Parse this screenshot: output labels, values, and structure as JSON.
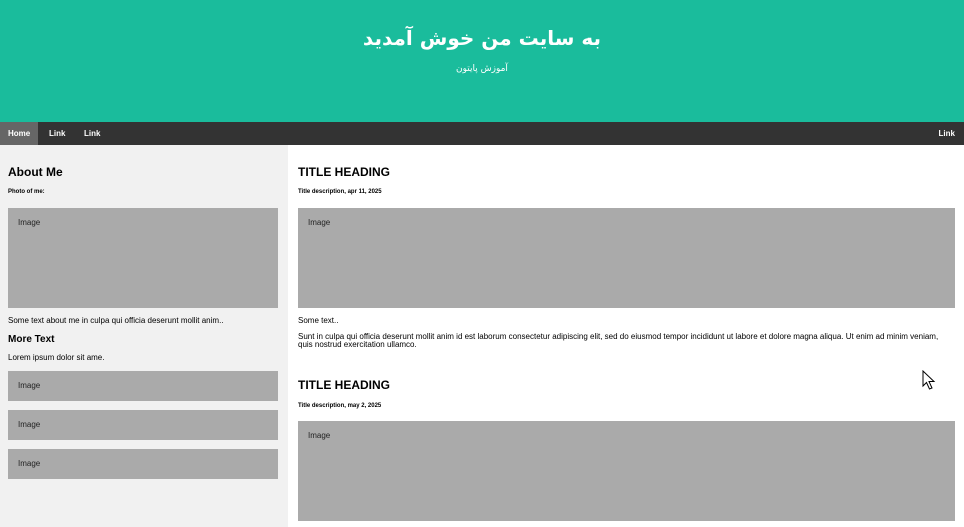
{
  "header": {
    "title": "به سایت من خوش آمدید",
    "subtitle": "آموزش پایتون"
  },
  "navbar": {
    "home": "Home",
    "link1": "Link",
    "link2": "Link",
    "link_right": "Link"
  },
  "side": {
    "heading": "About Me",
    "photo_label": "Photo of me:",
    "image_label": "Image",
    "about_text": "Some text about me in culpa qui officia deserunt mollit anim..",
    "more_heading": "More Text",
    "more_text": "Lorem ipsum dolor sit ame.",
    "small_images": [
      "Image",
      "Image",
      "Image"
    ]
  },
  "posts": [
    {
      "heading": "TITLE HEADING",
      "description": "Title description, apr 11, 2025",
      "image_label": "Image",
      "short_text": "Some text..",
      "long_text": "Sunt in culpa qui officia deserunt mollit anim id est laborum consectetur adipiscing elit, sed do eiusmod tempor incididunt ut labore et dolore magna aliqua. Ut enim ad minim veniam, quis nostrud exercitation ullamco."
    },
    {
      "heading": "TITLE HEADING",
      "description": "Title description, may 2, 2025",
      "image_label": "Image"
    }
  ],
  "colors": {
    "header_bg": "#1abc9c",
    "navbar_bg": "#333333",
    "nav_active_bg": "#666666",
    "side_bg": "#f1f1f1",
    "placeholder_bg": "#aaaaaa"
  },
  "icons": {
    "cursor": "mouse-pointer-icon"
  }
}
